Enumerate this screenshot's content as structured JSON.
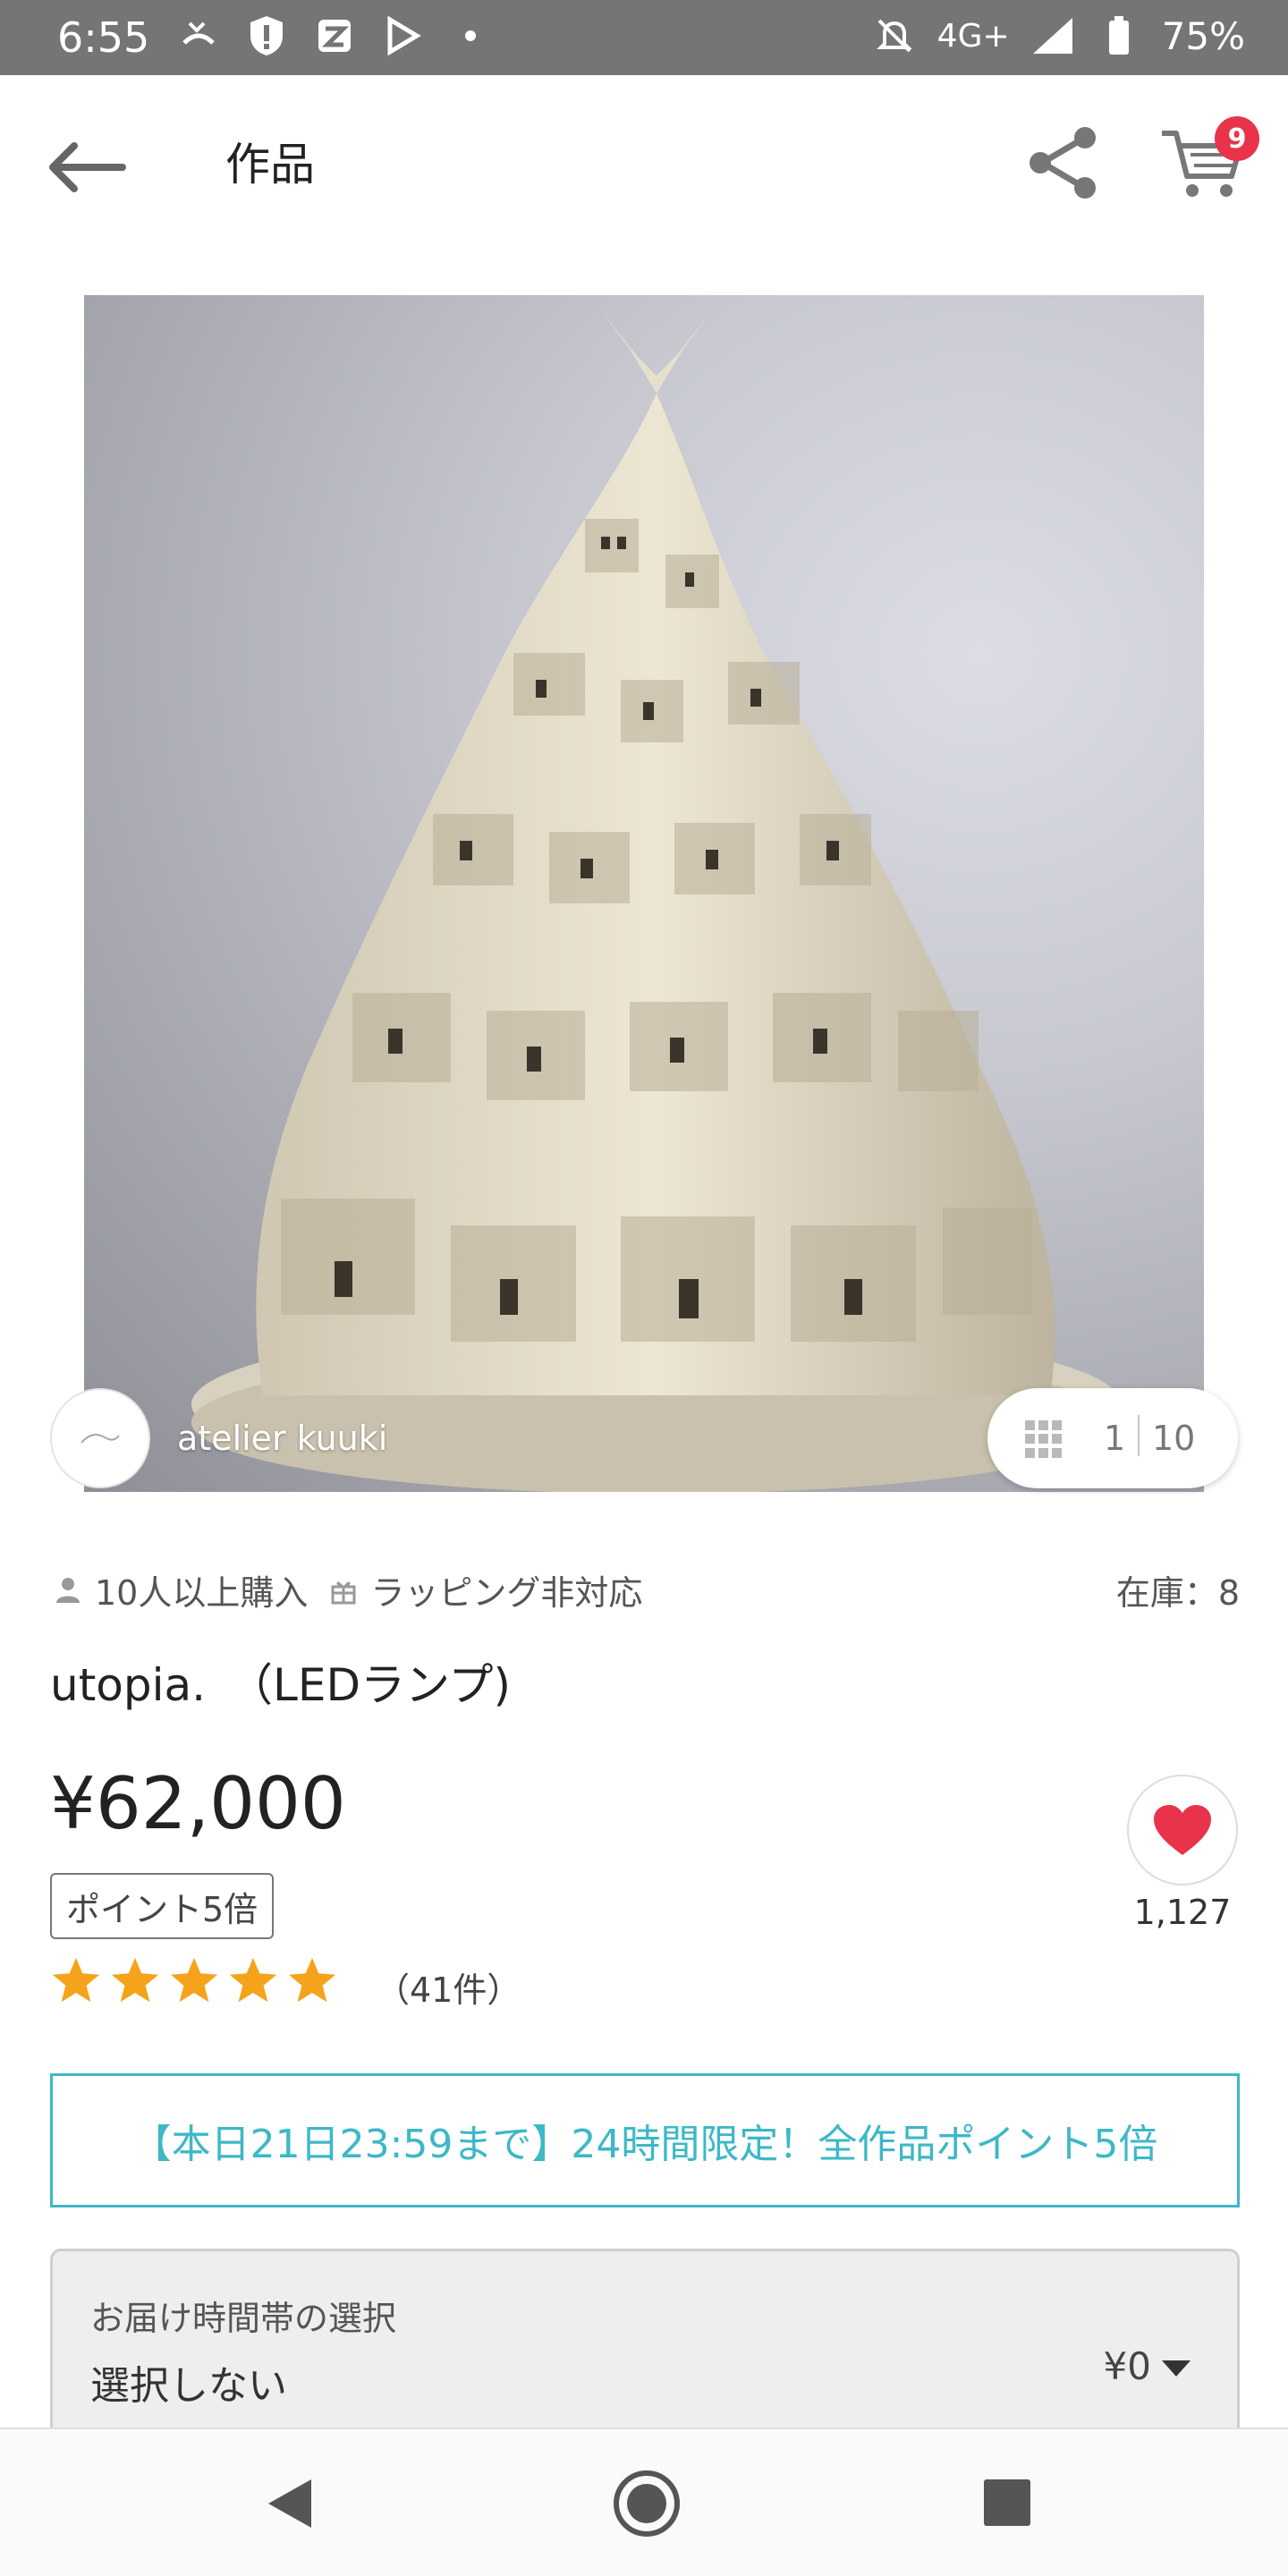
{
  "status_bar": {
    "time": "6:55",
    "network": "4G+",
    "battery": "75%",
    "icons": [
      "missed-call-icon",
      "shield-alert-icon",
      "app-icon",
      "play-store-icon",
      "dot-icon",
      "mute-icon",
      "signal-icon",
      "battery-icon"
    ]
  },
  "header": {
    "title": "作品",
    "cart_count": "9",
    "icons": [
      "back-arrow-icon",
      "share-icon",
      "cart-icon"
    ]
  },
  "gallery": {
    "shop_name": "atelier kuuki",
    "current_index": "1",
    "total": "10"
  },
  "product": {
    "purchase_info": "10人以上購入",
    "wrapping_info": "ラッピング非対応",
    "stock": "在庫：8",
    "title": "utopia.　（LEDランプ)",
    "price": "¥62,000",
    "point_badge": "ポイント5倍",
    "rating_stars": 5,
    "review_count": "（41件）",
    "favorite_count": "1,127"
  },
  "promo": {
    "text": "【本日21日23:59まで】24時間限定！全作品ポイント5倍"
  },
  "delivery": {
    "label": "お届け時間帯の選択",
    "value": "選択しない",
    "price": "¥0"
  },
  "colors": {
    "accent_teal": "#3db8c6",
    "heart_red": "#e8334a",
    "star_orange": "#f5a31a",
    "status_bar_gray": "#757575"
  }
}
